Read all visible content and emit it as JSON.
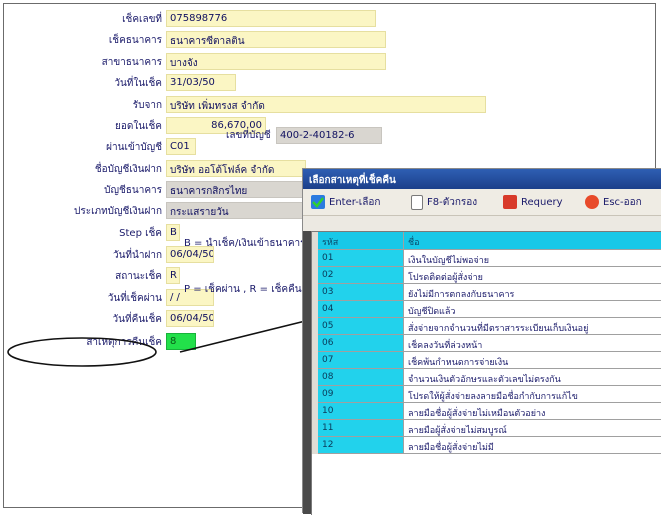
{
  "form": {
    "fields": [
      {
        "label": "เช็คเลขที่",
        "value": "075898776",
        "style": "yellow",
        "width": 210
      },
      {
        "label": "เช็คธนาคาร",
        "value": "ธนาคารซีตาลติน",
        "style": "yellow",
        "width": 220
      },
      {
        "label": "สาขาธนาคาร",
        "value": "บางจัง",
        "style": "yellow",
        "width": 220
      },
      {
        "label": "วันที่ในเช็ค",
        "value": "31/03/50",
        "style": "yellow",
        "width": 70
      },
      {
        "label": "รับจาก",
        "value": "บริษัท เพิ่มทรงส จำกัด",
        "style": "yellow",
        "width": 320
      },
      {
        "label": "ยอดในเช็ค",
        "value": "86,670.00",
        "style": "yellow",
        "width": 100,
        "align": "right"
      },
      {
        "label": "ผ่านเข้าบัญชี",
        "value": "C01",
        "style": "yellow",
        "width": 30
      },
      {
        "label": "ชื่อบัญชีเงินฝาก",
        "value": "บริษัท ออโต้โฟล์ค จำกัด",
        "style": "yellow",
        "width": 140
      },
      {
        "label": "บัญชีธนาคาร",
        "value": "ธนาคารกสิกรไทย",
        "style": "gray",
        "width": 140
      },
      {
        "label": "ประเภทบัญชีเงินฝาก",
        "value": "กระแสรายวัน",
        "style": "gray",
        "width": 140
      },
      {
        "label": "Step เช็ค",
        "value": "B",
        "style": "yellow",
        "width": 14
      },
      {
        "label": "วันที่นำฝาก",
        "value": "06/04/50",
        "style": "yellow",
        "width": 48
      },
      {
        "label": "สถานะเช็ค",
        "value": "R",
        "style": "yellow",
        "width": 14
      },
      {
        "label": "วันที่เช็คผ่าน",
        "value": "/ /",
        "style": "yellow",
        "width": 48
      },
      {
        "label": "วันที่คืนเช็ค",
        "value": "06/04/50",
        "style": "yellow",
        "width": 48
      },
      {
        "label": "สาเหตุการคืนเช็ค",
        "value": "8",
        "style": "green",
        "width": 30
      }
    ],
    "account_no_label": "เลขที่บัญชี",
    "account_no": "400-2-40182-6",
    "step_hint": "B = นำเช็ค/เงินเข้าธนาคาร",
    "status_hint": "P = เช็คผ่าน , R = เช็คคืน"
  },
  "popup": {
    "title": "เลือกสาเหตุที่เช็คคืน",
    "toolbar": {
      "enter_label": "Enter-เลือก",
      "filter_label": "F8-ตัวกรอง",
      "requery_label": "Requery",
      "esc_label": "Esc-ออก"
    },
    "grid": {
      "header_code": "รหัส",
      "header_desc": "ชื่อ",
      "rows": [
        {
          "code": "01",
          "desc": "เงินในบัญชีไม่พอจ่าย"
        },
        {
          "code": "02",
          "desc": "โปรดติดต่อผู้สั่งจ่าย"
        },
        {
          "code": "03",
          "desc": "ยังไม่มีการตกลงกับธนาคาร"
        },
        {
          "code": "04",
          "desc": "บัญชีปิดแล้ว"
        },
        {
          "code": "05",
          "desc": "สั่งจ่ายจากจำนวนที่มีตราสารระเบียนเก็บเงินอยู่"
        },
        {
          "code": "06",
          "desc": "เช็คลงวันที่ล่วงหน้า"
        },
        {
          "code": "07",
          "desc": "เช็คพ้นกำหนดการจ่ายเงิน"
        },
        {
          "code": "08",
          "desc": "จำนวนเงินตัวอักษรและตัวเลขไม่ตรงกัน"
        },
        {
          "code": "09",
          "desc": "โปรดให้ผู้สั่งจ่ายลงลายมือชื่อกำกับการแก้ไข"
        },
        {
          "code": "10",
          "desc": "ลายมือชื่อผู้สั่งจ่ายไม่เหมือนตัวอย่าง"
        },
        {
          "code": "11",
          "desc": "ลายมือผู้สั่งจ่ายไม่สมบูรณ์"
        },
        {
          "code": "12",
          "desc": "ลายมือชื่อผู้สั่งจ่ายไม่มี"
        }
      ]
    }
  },
  "colors": {
    "field_yellow": "#fbf6c4",
    "field_gray": "#d9d6d0",
    "field_green": "#22e04a",
    "title_blue": "#1c3f8a",
    "grid_cyan": "#22d2ec"
  }
}
